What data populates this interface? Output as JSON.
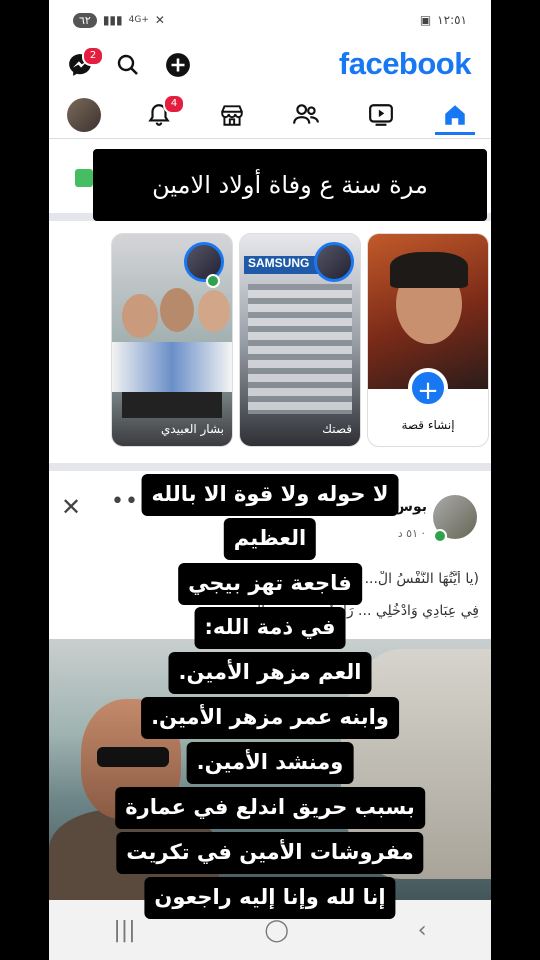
{
  "status_bar": {
    "time": "١٢:٥١",
    "battery": "٦٢",
    "network": "4G+"
  },
  "header": {
    "logo": "facebook",
    "messenger_badge": "2",
    "icons": [
      "messenger-icon",
      "search-icon",
      "plus-icon"
    ]
  },
  "nav": {
    "notifications_badge": "4",
    "items": [
      "home-icon",
      "video-icon",
      "friends-icon",
      "marketplace-icon",
      "notifications-icon",
      "profile-menu-icon"
    ]
  },
  "video_caption": "مرة سنة ع وفاة أولاد الامين",
  "stories": {
    "create_label": "إنشاء قصة",
    "items": [
      {
        "name": "قصتك"
      },
      {
        "name": "بشار العبيدي"
      }
    ]
  },
  "post": {
    "author": "بوس",
    "meta": "٥١ د ·",
    "line1": "(يا أَيَّتُهَا النَّفْسُ الْ... ـيَّةً مَرْضِيَّةً فَادْخُلِي",
    "line2": "فِي عِبَادِي وَادْخُلِي ... رَاجِعُو... عرض المزيد"
  },
  "overlay_lines": [
    "لا حوله ولا قوة الا بالله",
    "العظيم",
    "فاجعة تهز بيجي",
    "في ذمة الله:",
    "العم مزهر الأمين.",
    "وابنه عمر مزهر الأمين.",
    "ومنشد الأمين.",
    "بسبب حريق اندلع في عمارة",
    "مفروشات الأمين في تكريت",
    "إنا لله وإنا إليه راجعون"
  ],
  "colors": {
    "brand": "#1877f2",
    "badge": "#e41e3f",
    "online": "#31a24c"
  }
}
